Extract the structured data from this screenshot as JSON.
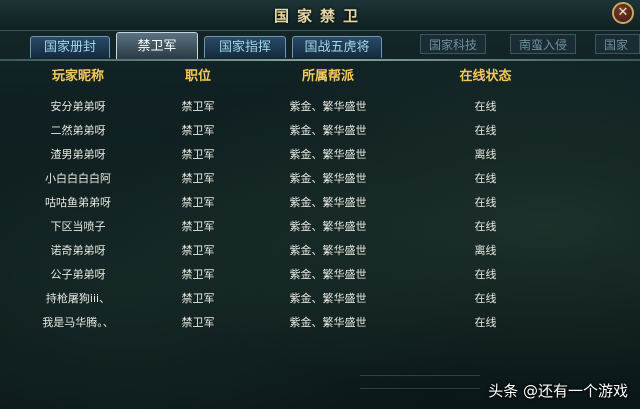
{
  "window": {
    "title": "国家禁卫",
    "close_glyph": "✕"
  },
  "tabs": [
    {
      "label": "国家册封",
      "active": false
    },
    {
      "label": "禁卫军",
      "active": true
    },
    {
      "label": "国家指挥",
      "active": false
    },
    {
      "label": "国战五虎将",
      "active": false
    }
  ],
  "background_tabs": [
    "国家科技",
    "南蛮入侵",
    "国家"
  ],
  "table": {
    "headers": [
      "玩家昵称",
      "职位",
      "所属帮派",
      "在线状态"
    ],
    "rows": [
      [
        "安分弟弟呀",
        "禁卫军",
        "紫金、繁华盛世",
        "在线"
      ],
      [
        "二然弟弟呀",
        "禁卫军",
        "紫金、繁华盛世",
        "在线"
      ],
      [
        "渣男弟弟呀",
        "禁卫军",
        "紫金、繁华盛世",
        "离线"
      ],
      [
        "小白白白白阿",
        "禁卫军",
        "紫金、繁华盛世",
        "在线"
      ],
      [
        "咕咕鱼弟弟呀",
        "禁卫军",
        "紫金、繁华盛世",
        "在线"
      ],
      [
        "下区当喷子",
        "禁卫军",
        "紫金、繁华盛世",
        "在线"
      ],
      [
        "诺奇弟弟呀",
        "禁卫军",
        "紫金、繁华盛世",
        "离线"
      ],
      [
        "公子弟弟呀",
        "禁卫军",
        "紫金、繁华盛世",
        "在线"
      ],
      [
        "持枪屠狗iii、",
        "禁卫军",
        "紫金、繁华盛世",
        "在线"
      ],
      [
        "我是马华腾。、",
        "禁卫军",
        "紫金、繁华盛世",
        "在线"
      ]
    ]
  },
  "watermark": "头条 @还有一个游戏"
}
